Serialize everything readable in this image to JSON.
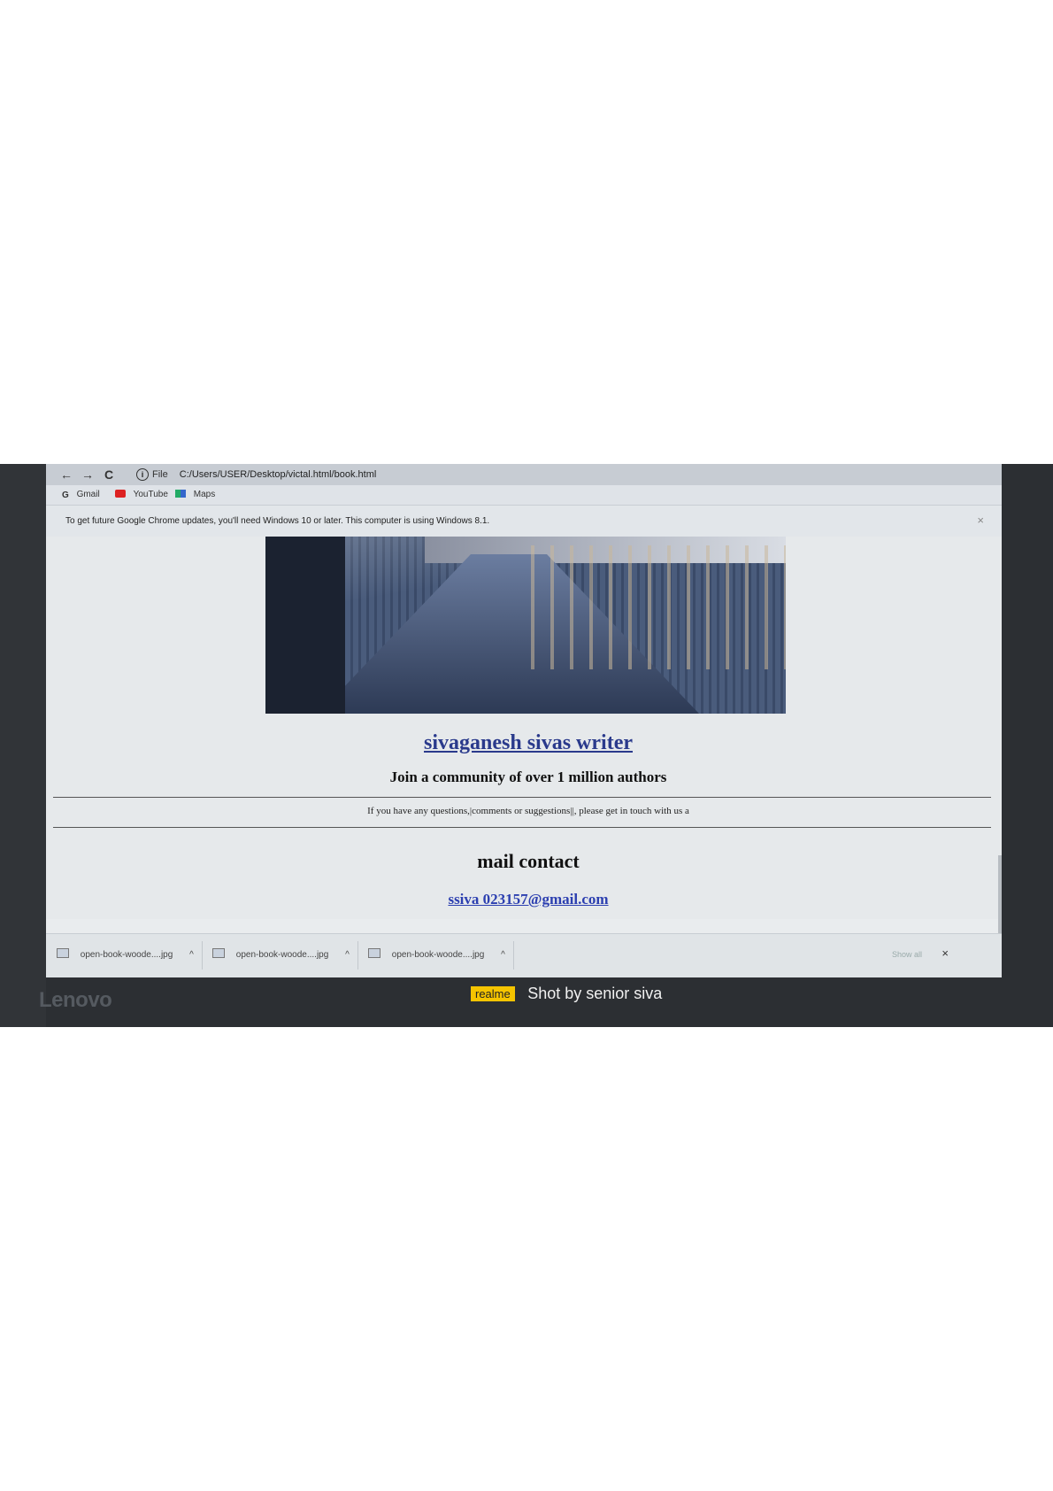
{
  "browser": {
    "nav_back": "←",
    "nav_forward": "→",
    "nav_reload": "C",
    "address_scheme": "File",
    "address_url": "C:/Users/USER/Desktop/victal.html/book.html",
    "bookmarks": [
      {
        "label": "Gmail",
        "icon": "google-icon"
      },
      {
        "label": "YouTube",
        "icon": "youtube-icon"
      },
      {
        "label": "Maps",
        "icon": "maps-icon"
      }
    ],
    "infobar_message": "To get future Google Chrome updates, you'll need Windows 10 or later. This computer is using Windows 8.1.",
    "infobar_close": "×"
  },
  "page": {
    "title": "sivaganesh sivas writer",
    "subtitle": "Join a community of over 1 million authors",
    "note": "If you have any questions,|comments or suggestions||, please get in touch with us a",
    "mail_heading": "mail contact",
    "mail_link": "ssiva 023157@gmail.com"
  },
  "downloads": {
    "items": [
      {
        "name": "open-book-woode....jpg"
      },
      {
        "name": "open-book-woode....jpg"
      },
      {
        "name": "open-book-woode....jpg"
      }
    ],
    "chevron": "^",
    "show_all": "Show all",
    "close": "×"
  },
  "device": {
    "brand": "Lenovo",
    "watermark_badge": "realme",
    "watermark_text": "Shot by senior siva"
  },
  "colors": {
    "link": "#2a3a8c",
    "watermark_badge": "#f5c400"
  }
}
